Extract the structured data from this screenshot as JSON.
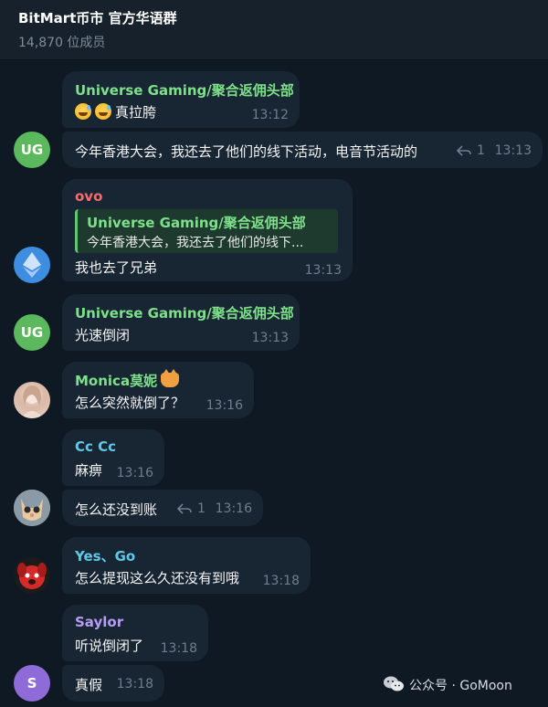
{
  "header": {
    "title": "BitMart币市 官方华语群",
    "subtitle": "14,870 位成员"
  },
  "colors": {
    "background": "#0f1923",
    "bubble": "#182533",
    "name_green": "#7ee08a",
    "name_red": "#ff6b6b",
    "name_cyan": "#62c8e8",
    "name_purple": "#b79cf4",
    "time": "#6d7f8f"
  },
  "messages": [
    {
      "sender": "Universe Gaming/聚合返佣头部",
      "text": "真拉胯",
      "emoji": "sweat-smile-emoji",
      "time": "13:12"
    },
    {
      "text": "今年香港大会，我还去了他们的线下活动，电音节活动的",
      "replies": "1",
      "time": "13:13",
      "avatar": "UG"
    },
    {
      "sender": "ovo",
      "quote_name": "Universe Gaming/聚合返佣头部",
      "quote_text": "今年香港大会，我还去了他们的线下...",
      "text": "我也去了兄弟",
      "time": "13:13",
      "avatar_icon": "ethereum-icon"
    },
    {
      "sender": "Universe Gaming/聚合返佣头部",
      "text": "光速倒闭",
      "time": "13:13",
      "avatar": "UG"
    },
    {
      "sender": "Monica莫妮",
      "sender_emoji": "cat-emoji",
      "text": "怎么突然就倒了？",
      "time": "13:16",
      "avatar_icon": "person-avatar"
    },
    {
      "sender": "Cc Cc",
      "text": "麻痹",
      "time": "13:16"
    },
    {
      "text": "怎么还没到账",
      "replies": "1",
      "time": "13:16",
      "avatar_icon": "cat-avatar"
    },
    {
      "sender": "Yes、Go",
      "text": "怎么提现这么久还没有到哦",
      "time": "13:18",
      "avatar_icon": "red-dog-avatar"
    },
    {
      "sender": "Saylor",
      "text": "听说倒闭了",
      "time": "13:18"
    },
    {
      "text": "真假",
      "time": "13:18",
      "avatar": "S"
    }
  ],
  "watermark": "公众号 · GoMoon"
}
